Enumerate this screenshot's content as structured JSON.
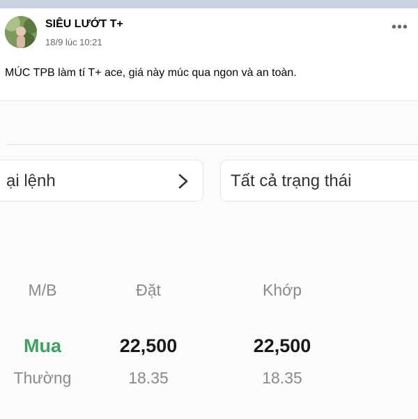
{
  "post": {
    "author": "SIÊU LƯỚT T+",
    "timestamp": "18/9 lúc 10:21",
    "more_icon": "more-horizontal-icon",
    "caption": "MÚC TPB làm tí T+ ace, giá này múc qua ngon và an toàn."
  },
  "screenshot": {
    "filters": {
      "order_type": "ại lệnh",
      "status": "Tất cả trạng thái",
      "chevron_icon": "chevron-right-icon"
    },
    "table": {
      "headers": [
        "M/B",
        "Đặt",
        "Khớp"
      ],
      "rows": [
        {
          "side": "Mua",
          "side_type": "Thường",
          "order_price": "22,500",
          "order_sub": "18.35",
          "match_price": "22,500",
          "match_sub": "18.35"
        }
      ]
    },
    "colors": {
      "buy": "#3aa35f",
      "muted": "#8a8a8a"
    }
  }
}
